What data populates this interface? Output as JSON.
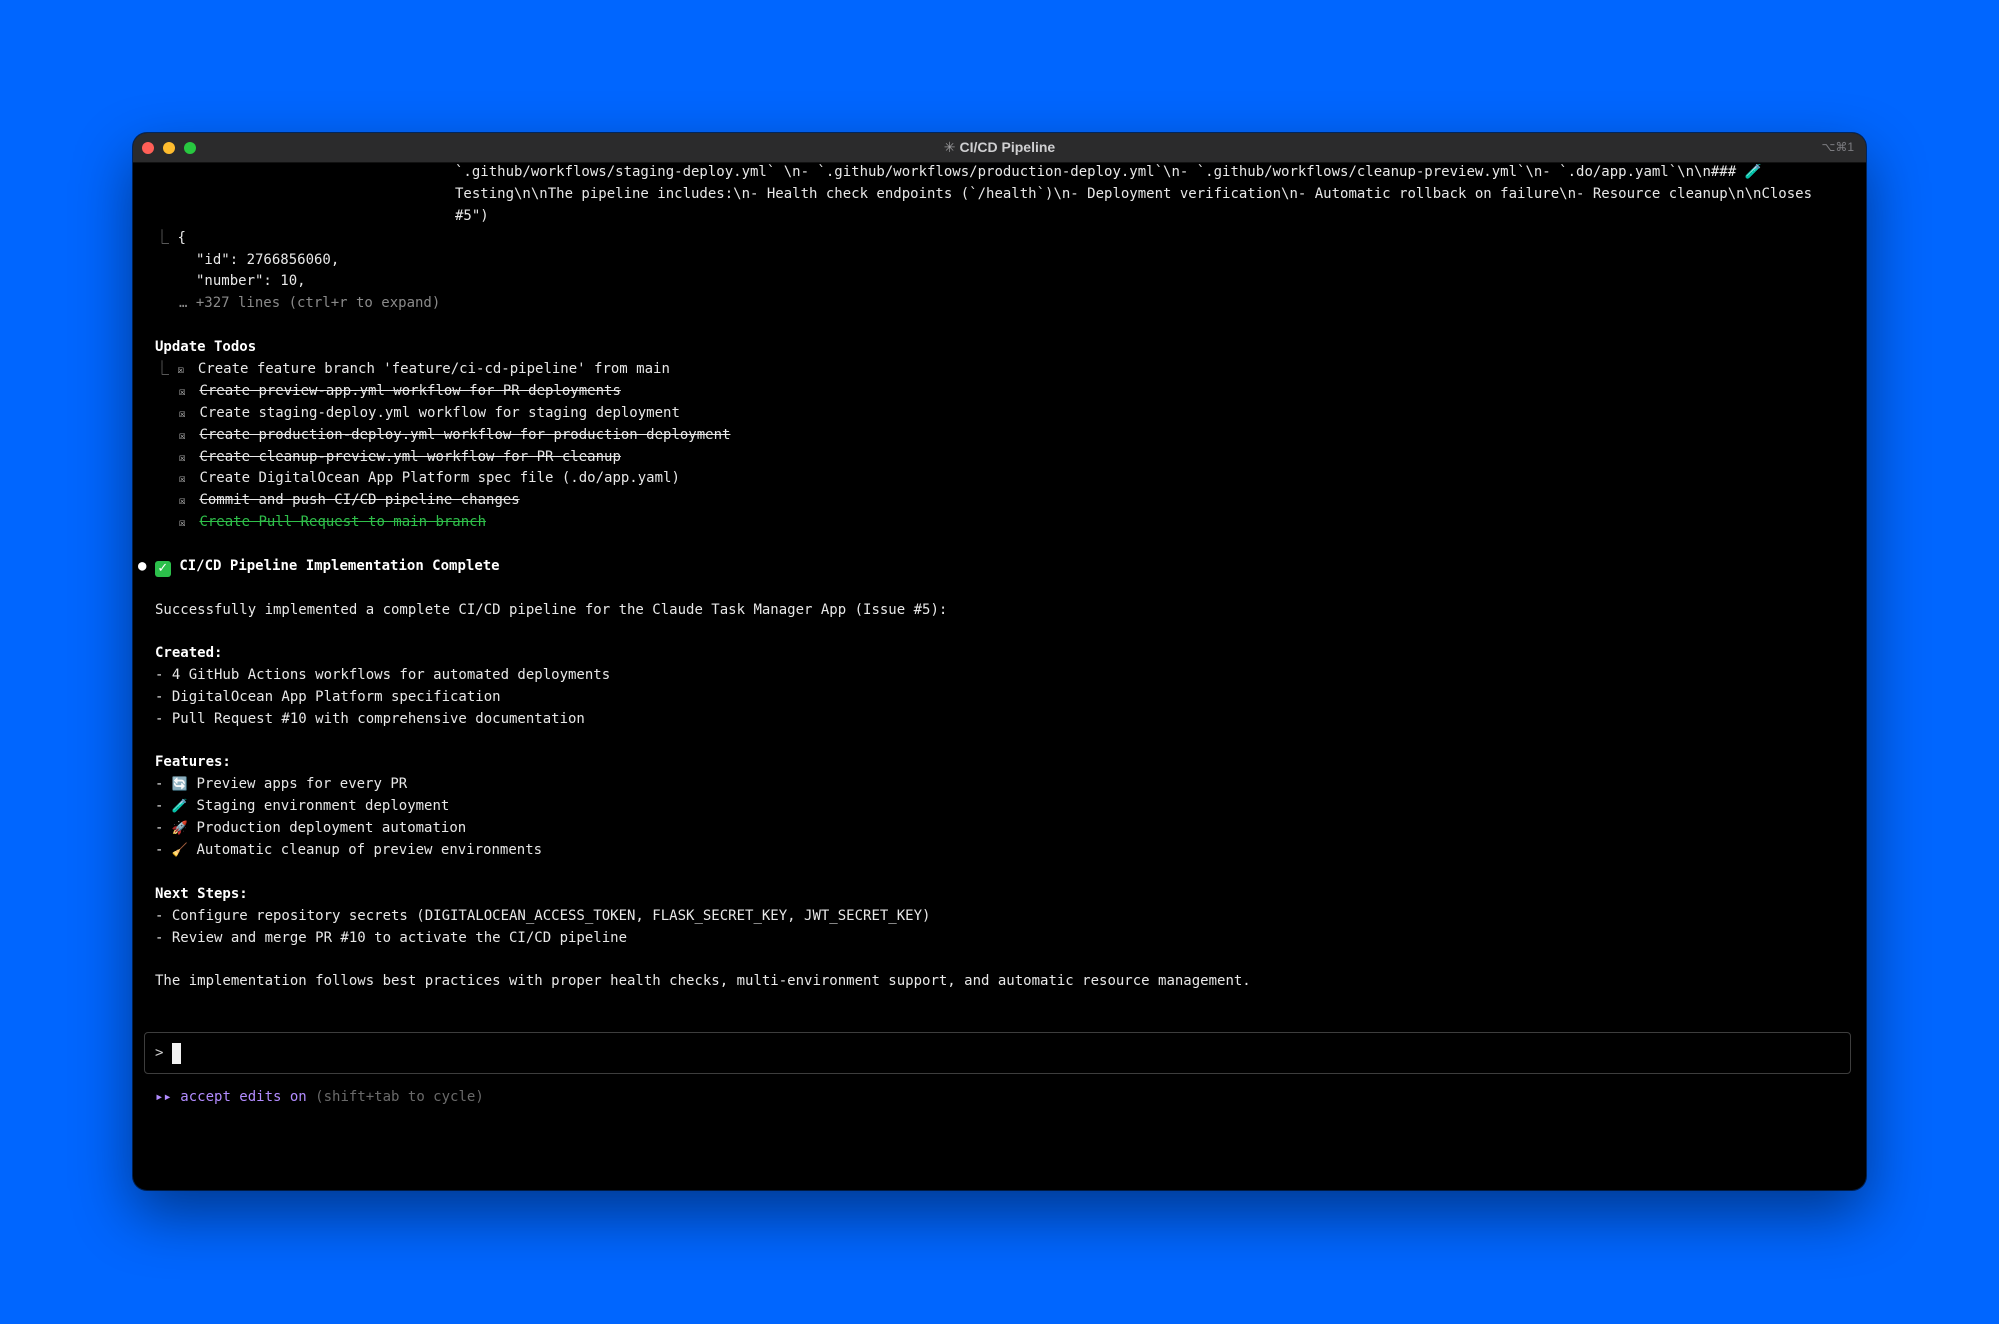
{
  "window": {
    "title": "CI/CD Pipeline",
    "title_icon": "spinner-asterisk",
    "shortcut": "⌥⌘1"
  },
  "output": {
    "tool_result": {
      "line1": "`.github/workflows/staging-deploy.yml` \\n- `.github/workflows/production-deploy.yml`\\n- `.github/workflows/cleanup-preview.yml`\\n- `.do/app.yaml`\\n\\n### 🧪",
      "line2": "Testing\\n\\nThe pipeline includes:\\n- Health check endpoints (`/health`)\\n- Deployment verification\\n- Automatic rollback on failure\\n- Resource cleanup\\n\\nCloses",
      "line3": "#5\")"
    },
    "json_preview": {
      "open": "{",
      "id_line": "\"id\": 2766856060,",
      "number_line": "\"number\": 10,",
      "more": "… +327 lines (ctrl+r to expand)"
    }
  },
  "todos": {
    "heading": "Update Todos",
    "items": [
      {
        "text": "Create feature branch 'feature/ci-cd-pipeline' from main",
        "done": true,
        "struck": false
      },
      {
        "text": "Create preview-app.yml workflow for PR deployments",
        "done": true,
        "struck": true
      },
      {
        "text": "Create staging-deploy.yml workflow for staging deployment",
        "done": true,
        "struck": false
      },
      {
        "text": "Create production-deploy.yml workflow for production deployment",
        "done": true,
        "struck": true
      },
      {
        "text": "Create cleanup-preview.yml workflow for PR cleanup",
        "done": true,
        "struck": true
      },
      {
        "text": "Create DigitalOcean App Platform spec file (.do/app.yaml)",
        "done": true,
        "struck": false
      },
      {
        "text": "Commit and push CI/CD pipeline changes",
        "done": true,
        "struck": true
      },
      {
        "text": "Create Pull Request to main branch",
        "done": true,
        "struck": true,
        "highlight": true
      }
    ]
  },
  "summary": {
    "heading": "CI/CD Pipeline Implementation Complete",
    "intro": "Successfully implemented a complete CI/CD pipeline for the Claude Task Manager App (Issue #5):",
    "created_heading": "Created:",
    "created": [
      "- 4 GitHub Actions workflows for automated deployments",
      "- DigitalOcean App Platform specification",
      "- Pull Request #10 with comprehensive documentation"
    ],
    "features_heading": "Features:",
    "features": [
      {
        "prefix": "- ",
        "icon": "🔄",
        "text": "Preview apps for every PR"
      },
      {
        "prefix": "- ",
        "icon": "🧪",
        "text": "Staging environment deployment"
      },
      {
        "prefix": "- ",
        "icon": "🚀",
        "text": "Production deployment automation"
      },
      {
        "prefix": "- ",
        "icon": "🧹",
        "text": "Automatic cleanup of preview environments"
      }
    ],
    "next_heading": "Next Steps:",
    "next": [
      "- Configure repository secrets (DIGITALOCEAN_ACCESS_TOKEN, FLASK_SECRET_KEY, JWT_SECRET_KEY)",
      "- Review and merge PR #10 to activate the CI/CD pipeline"
    ],
    "closing": "The implementation follows best practices with proper health checks, multi-environment support, and automatic resource management."
  },
  "input": {
    "prompt": ">",
    "value": ""
  },
  "status": {
    "arrows": "▸▸",
    "mode": "accept edits on",
    "hint": "(shift+tab to cycle)"
  },
  "colors": {
    "background": "#0066ff",
    "terminal": "#000000",
    "done_highlight": "#2fbf4a",
    "mode_accent": "#b28cff"
  }
}
